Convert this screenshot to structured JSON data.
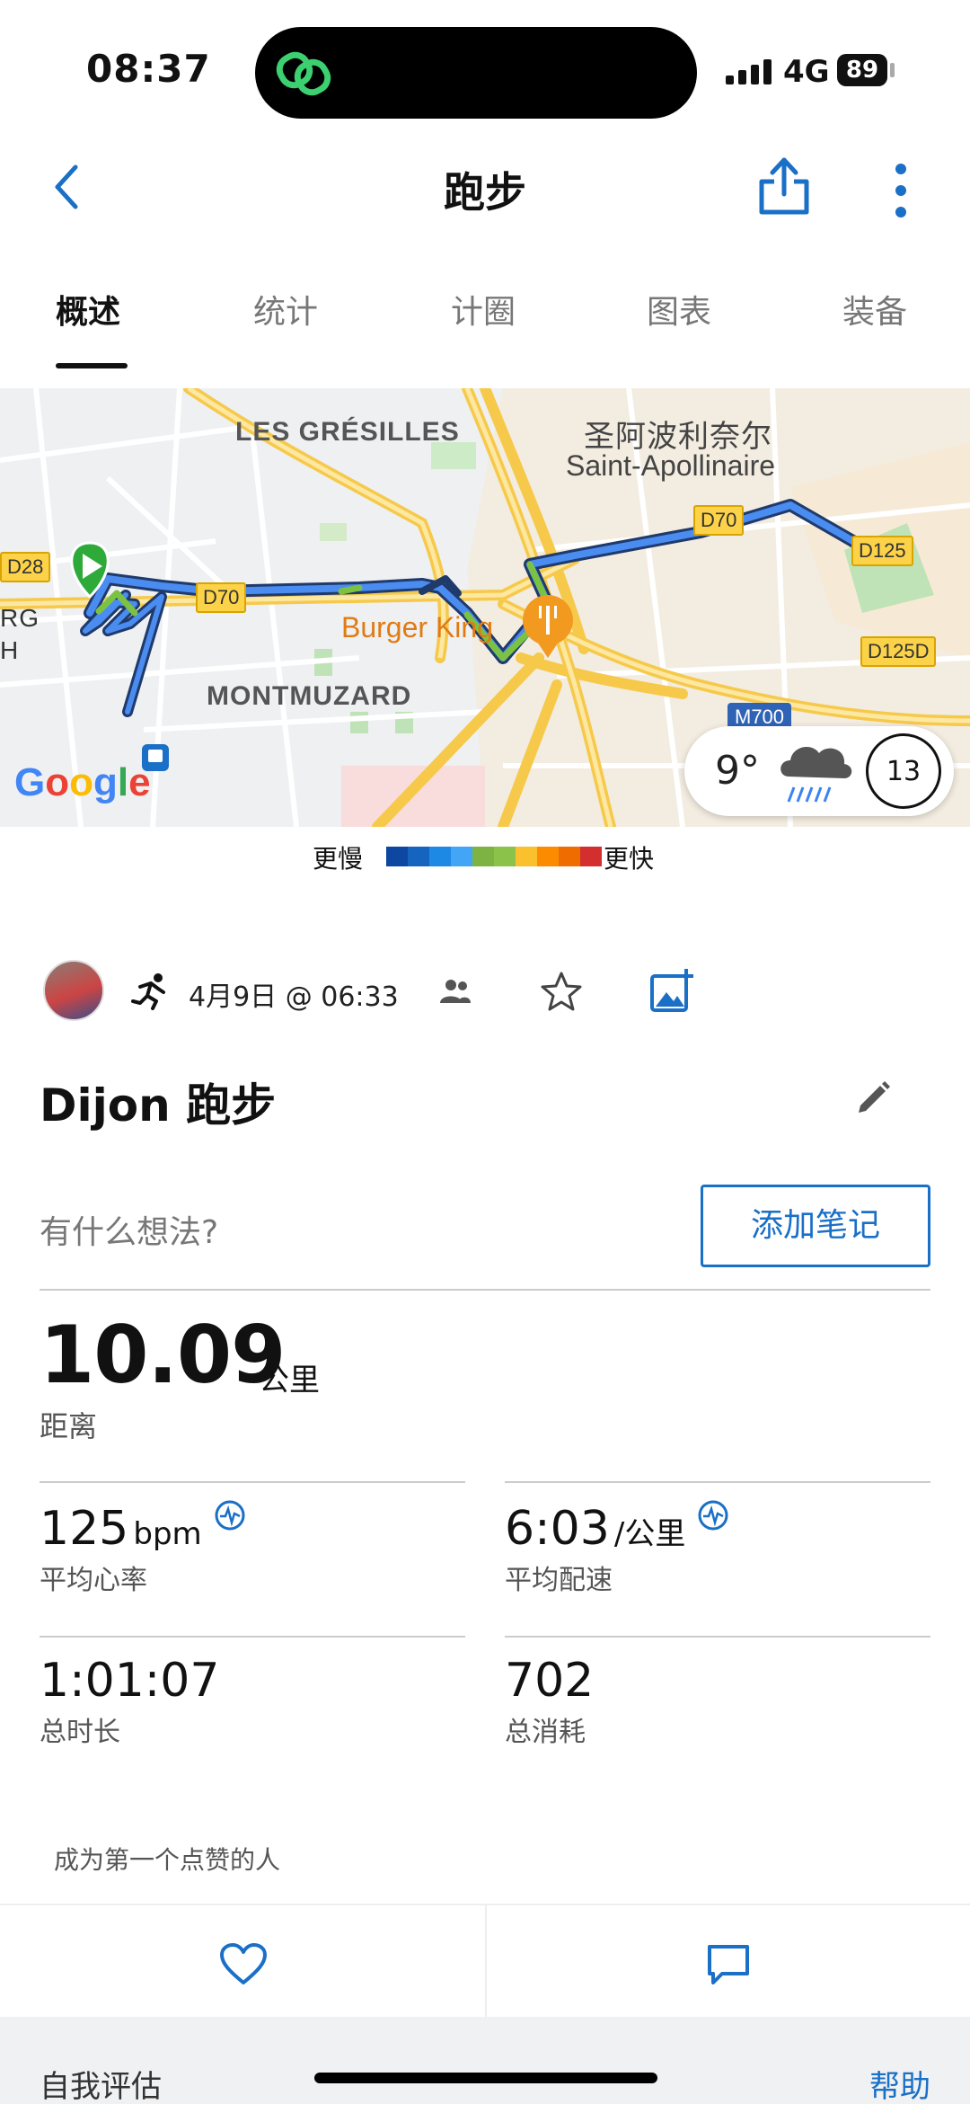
{
  "status_bar": {
    "time": "08:37",
    "network": "4G",
    "battery": "89"
  },
  "header": {
    "title": "跑步"
  },
  "tabs": [
    {
      "label": "概述",
      "active": true
    },
    {
      "label": "统计",
      "active": false
    },
    {
      "label": "计圈",
      "active": false
    },
    {
      "label": "图表",
      "active": false
    },
    {
      "label": "装备",
      "active": false
    }
  ],
  "map": {
    "labels": {
      "les_gresilles": "LES GRÉSILLES",
      "saint_apollinaire_cn": "圣阿波利奈尔",
      "saint_apollinaire": "Saint-Apollinaire",
      "montmuzard": "MONTMUZARD",
      "burger_king": "Burger King",
      "rg": "RG",
      "h": "H"
    },
    "roads": {
      "d28": "D28",
      "d70_left": "D70",
      "d70_right": "D70",
      "d125": "D125",
      "d125d": "D125D",
      "m700": "M700"
    },
    "weather": {
      "temp": "9°",
      "wind": "13",
      "icon": "rain-cloud-icon"
    },
    "attribution": "Google"
  },
  "legend": {
    "slower": "更慢",
    "faster": "更快",
    "colors": [
      "#0d47a1",
      "#1565c0",
      "#1e88e5",
      "#42a5f5",
      "#7cb342",
      "#8bc34a",
      "#fbc02d",
      "#fb8c00",
      "#ef6c00",
      "#d32f2f"
    ]
  },
  "activity": {
    "date": "4月9日 @ 06:33",
    "title": "Dijon 跑步",
    "note_prompt": "有什么想法?",
    "add_note": "添加笔记"
  },
  "stats": {
    "distance": {
      "value": "10.09",
      "unit": "公里",
      "label": "距离"
    },
    "avg_hr": {
      "value": "125",
      "unit": "bpm",
      "label": "平均心率"
    },
    "avg_pace": {
      "value": "6:03",
      "unit": "/公里",
      "label": "平均配速"
    },
    "duration": {
      "value": "1:01:07",
      "label": "总时长"
    },
    "calories": {
      "value": "702",
      "label": "总消耗"
    }
  },
  "social": {
    "likes_text": "成为第一个点赞的人"
  },
  "footer": {
    "self_eval": "自我评估",
    "help": "帮助"
  },
  "colors": {
    "accent": "#1a6fc7",
    "route": "#3b82f6",
    "route_green": "#7cc242",
    "road_yellow": "#f6c94a"
  }
}
